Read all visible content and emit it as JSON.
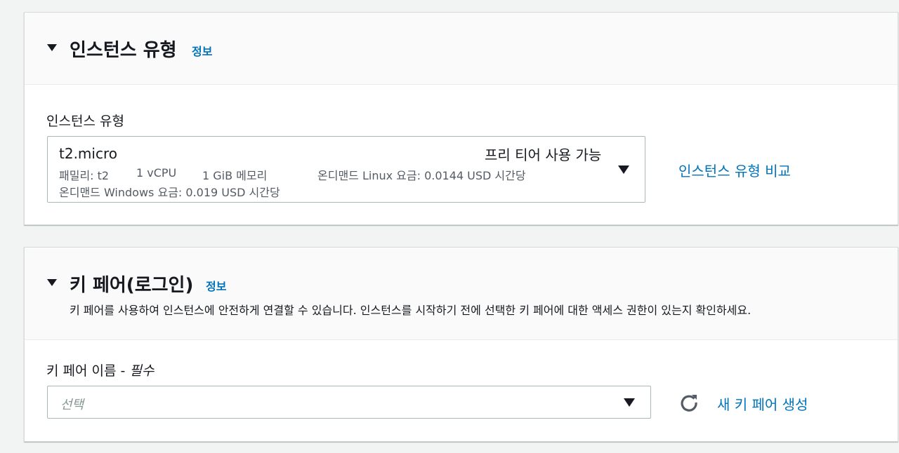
{
  "instance_type_panel": {
    "title": "인스턴스 유형",
    "info": "정보",
    "field_label": "인스턴스 유형",
    "selected": {
      "name": "t2.micro",
      "free_tier": "프리 티어 사용 가능",
      "family": "패밀리: t2",
      "vcpu": "1 vCPU",
      "memory": "1 GiB 메모리",
      "linux_price": "온디맨드 Linux 요금: 0.0144 USD 시간당",
      "windows_price": "온디맨드 Windows 요금: 0.019 USD 시간당"
    },
    "compare_link": "인스턴스 유형 비교"
  },
  "key_pair_panel": {
    "title": "키 페어(로그인)",
    "info": "정보",
    "description": "키 페어를 사용하여 인스턴스에 안전하게 연결할 수 있습니다. 인스턴스를 시작하기 전에 선택한 키 페어에 대한 액세스 권한이 있는지 확인하세요.",
    "field_label": "키 페어 이름 - ",
    "required": "필수",
    "placeholder": "선택",
    "create_link": "새 키 페어 생성"
  },
  "colors": {
    "link": "#0073bb",
    "background": "#f2f3f3",
    "header_bg": "#fafafa"
  },
  "icons": [
    "caret-down-icon",
    "refresh-icon"
  ]
}
